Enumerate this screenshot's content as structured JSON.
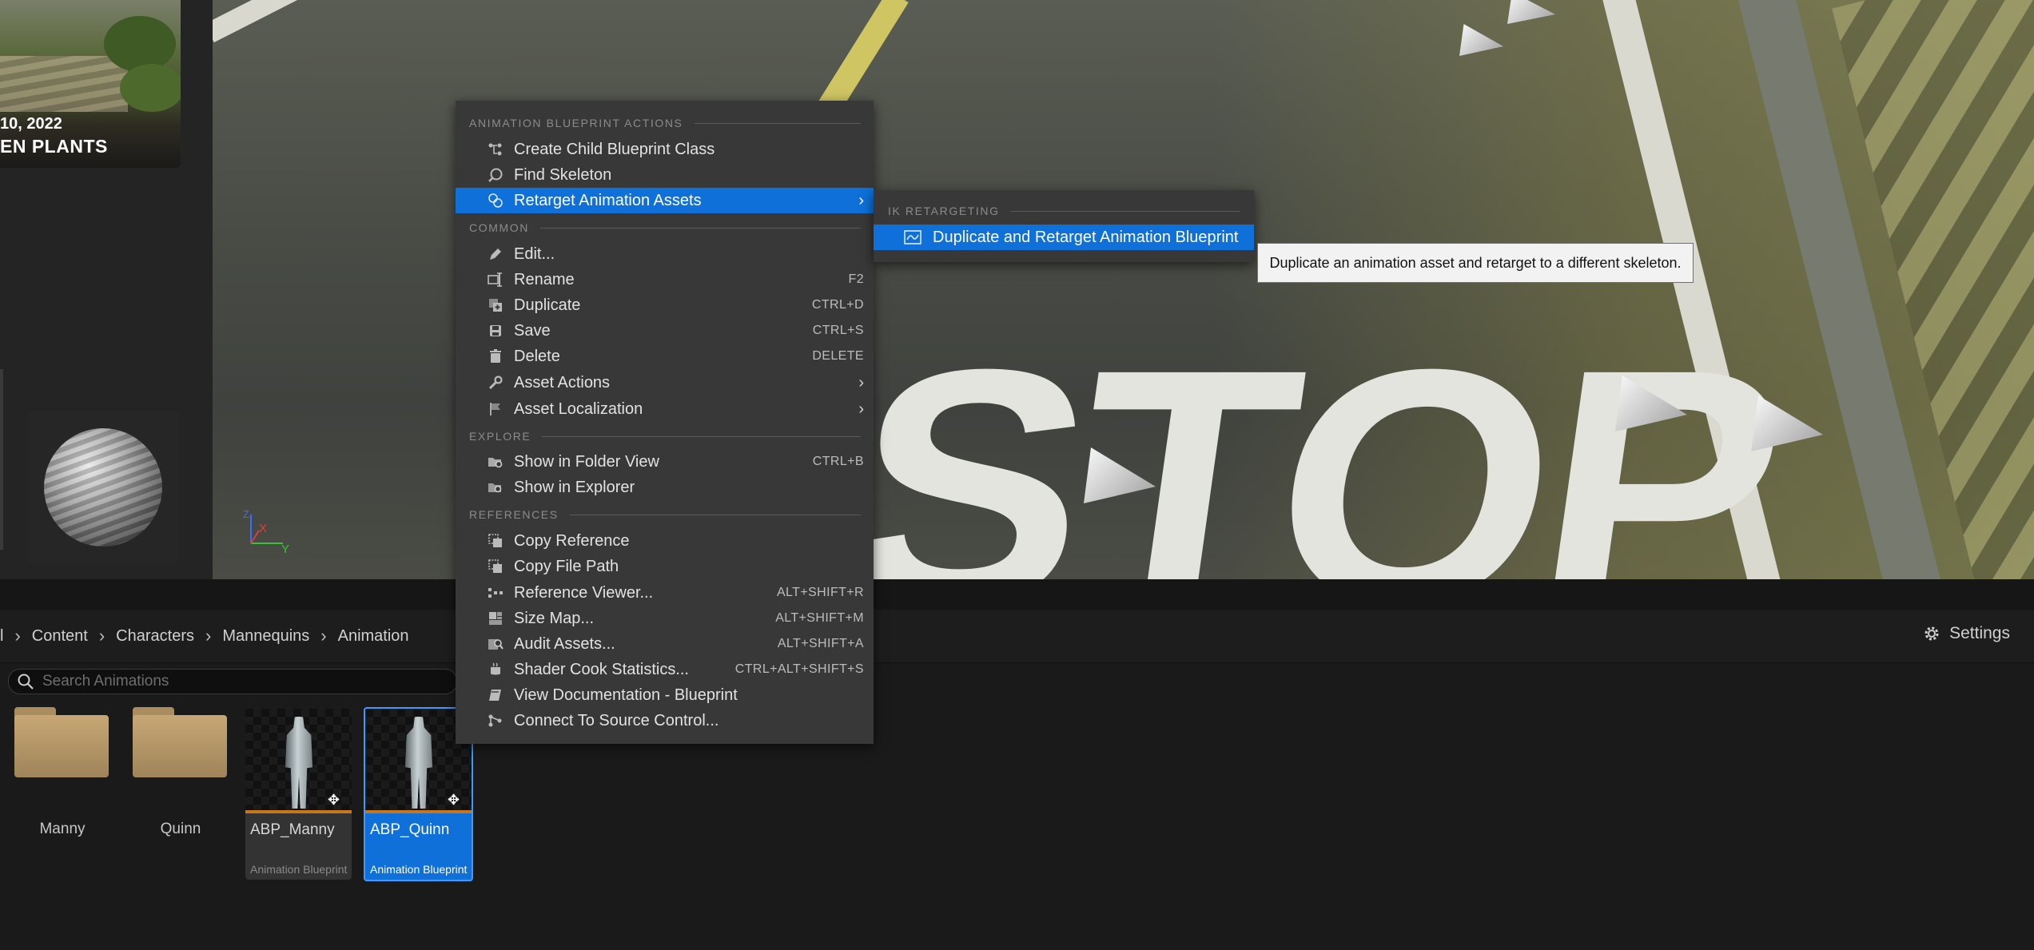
{
  "left_panel": {
    "card": {
      "date": "10, 2022",
      "title": "EN PLANTS"
    }
  },
  "viewport": {
    "road_text": "STOP",
    "axis": {
      "x_label": "X",
      "y_label": "Y",
      "z_label": "Z"
    }
  },
  "context_menu": {
    "sections": [
      {
        "header": "ANIMATION BLUEPRINT ACTIONS",
        "items": [
          {
            "label": "Create Child Blueprint Class",
            "icon": "child-class-icon",
            "shortcut": ""
          },
          {
            "label": "Find Skeleton",
            "icon": "find-icon",
            "shortcut": ""
          },
          {
            "label": "Retarget Animation Assets",
            "icon": "retarget-icon",
            "shortcut": "",
            "submenu": true,
            "active": true
          }
        ]
      },
      {
        "header": "COMMON",
        "items": [
          {
            "label": "Edit...",
            "icon": "edit-icon",
            "shortcut": ""
          },
          {
            "label": "Rename",
            "icon": "rename-icon",
            "shortcut": "F2"
          },
          {
            "label": "Duplicate",
            "icon": "duplicate-icon",
            "shortcut": "CTRL+D"
          },
          {
            "label": "Save",
            "icon": "save-icon",
            "shortcut": "CTRL+S"
          },
          {
            "label": "Delete",
            "icon": "delete-icon",
            "shortcut": "DELETE"
          },
          {
            "label": "Asset Actions",
            "icon": "wrench-icon",
            "shortcut": "",
            "submenu": true
          },
          {
            "label": "Asset Localization",
            "icon": "flag-icon",
            "shortcut": "",
            "submenu": true
          }
        ]
      },
      {
        "header": "EXPLORE",
        "items": [
          {
            "label": "Show in Folder View",
            "icon": "folder-view-icon",
            "shortcut": "CTRL+B"
          },
          {
            "label": "Show in Explorer",
            "icon": "explorer-icon",
            "shortcut": ""
          }
        ]
      },
      {
        "header": "REFERENCES",
        "items": [
          {
            "label": "Copy Reference",
            "icon": "copy-icon",
            "shortcut": ""
          },
          {
            "label": "Copy File Path",
            "icon": "copy-path-icon",
            "shortcut": ""
          },
          {
            "label": "Reference Viewer...",
            "icon": "reference-viewer-icon",
            "shortcut": "ALT+SHIFT+R"
          },
          {
            "label": "Size Map...",
            "icon": "size-map-icon",
            "shortcut": "ALT+SHIFT+M"
          },
          {
            "label": "Audit Assets...",
            "icon": "audit-icon",
            "shortcut": "ALT+SHIFT+A"
          },
          {
            "label": "Shader Cook Statistics...",
            "icon": "shader-icon",
            "shortcut": "CTRL+ALT+SHIFT+S"
          },
          {
            "label": "View Documentation - Blueprint",
            "icon": "book-icon",
            "shortcut": ""
          },
          {
            "label": "Connect To Source Control...",
            "icon": "source-control-icon",
            "shortcut": ""
          }
        ]
      }
    ]
  },
  "submenu": {
    "header": "IK RETARGETING",
    "items": [
      {
        "label": "Duplicate and Retarget Animation Blueprint",
        "icon": "anim-blueprint-icon",
        "active": true
      }
    ]
  },
  "tooltip": {
    "text": "Duplicate an animation asset and retarget to a different skeleton."
  },
  "content_browser": {
    "breadcrumb": [
      "l",
      "Content",
      "Characters",
      "Mannequins",
      "Animation"
    ],
    "settings_label": "Settings",
    "search_placeholder": "Search Animations",
    "folders": [
      {
        "label": "Manny"
      },
      {
        "label": "Quinn"
      }
    ],
    "assets": [
      {
        "name": "ABP_Manny",
        "type": "Animation Blueprint",
        "selected": false
      },
      {
        "name": "ABP_Quinn",
        "type": "Animation Blueprint",
        "selected": true
      }
    ]
  },
  "colors": {
    "selection_blue": "#0e70d8",
    "menu_bg": "#383838",
    "accent_orange": "#c9751b"
  }
}
